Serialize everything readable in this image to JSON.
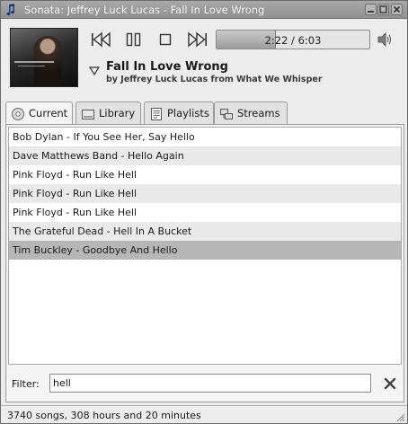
{
  "window": {
    "title": "Sonata: Jeffrey Luck Lucas - Fall In Love Wrong",
    "icons": {
      "app": "music-note-icon",
      "minimize": "minimize-icon",
      "maximize": "maximize-icon",
      "close": "close-icon"
    }
  },
  "player": {
    "cover_icon": "album-cover",
    "controls": {
      "prev": "skip-back-icon",
      "pause": "pause-icon",
      "stop": "stop-icon",
      "next": "skip-forward-icon"
    },
    "progress_text": "2:22 / 6:03",
    "progress_fraction": 0.391,
    "volume_icon": "speaker-icon",
    "song_title": "Fall In Love Wrong",
    "song_sub": "by Jeffrey Luck Lucas from What We Whisper"
  },
  "tabs": [
    {
      "label": "Current",
      "icon": "disc-icon",
      "active": true
    },
    {
      "label": "Library",
      "icon": "drive-icon",
      "active": false
    },
    {
      "label": "Playlists",
      "icon": "document-list-icon",
      "active": false
    },
    {
      "label": "Streams",
      "icon": "network-icon",
      "active": false
    }
  ],
  "playlist": {
    "rows": [
      "Bob Dylan - If You See Her, Say Hello",
      "Dave Matthews Band - Hello Again",
      "Pink Floyd - Run Like Hell",
      "Pink Floyd - Run Like Hell",
      "Pink Floyd - Run Like Hell",
      "The Grateful Dead - Hell In A Bucket",
      "Tim Buckley - Goodbye And Hello"
    ],
    "selected_index": 6
  },
  "filter": {
    "label": "Filter:",
    "value": "hell"
  },
  "status": {
    "text": "3740 songs, 308 hours and 20 minutes"
  },
  "colors": {
    "titlebar": "#9d9d9d",
    "selection": "#b6b6b6",
    "alt_row": "#e9e9e9"
  }
}
